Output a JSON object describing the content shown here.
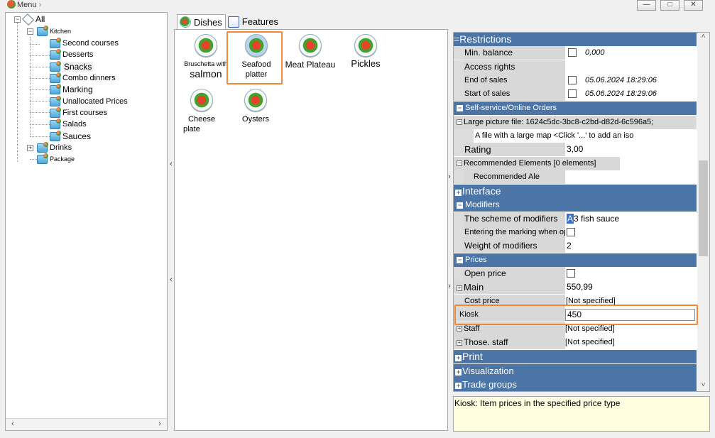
{
  "window": {
    "title": "Menu",
    "minimize": "—",
    "maximize": "□",
    "close": "✕"
  },
  "tree": {
    "root": "All",
    "kitchen": "Kitchen",
    "kitchen_items": [
      "Second courses",
      "Desserts",
      "Snacks",
      "Combo dinners",
      "Marking",
      "Unallocated Prices",
      "First courses",
      "Salads",
      "Sauces"
    ],
    "drinks": "Drinks",
    "package": "Package"
  },
  "tabs": {
    "dishes": "Dishes",
    "features": "Features"
  },
  "dishes": [
    {
      "line1": "Bruschetta with",
      "line2": "salmon"
    },
    {
      "line1": "Seafood",
      "line2": "platter"
    },
    {
      "line1": "Meat Plateau",
      "line2": ""
    },
    {
      "line1": "Pickles",
      "line2": ""
    },
    {
      "line1": "Cheese",
      "line2": "plate"
    },
    {
      "line1": "Oysters",
      "line2": ""
    }
  ],
  "properties": {
    "restrictions": "=Restrictions",
    "min_balance": {
      "name": "Min. balance",
      "value": "0,000"
    },
    "access_rights": {
      "name": "Access rights"
    },
    "end_of_sales": {
      "name": "End of sales",
      "value": "05.06.2024 18:29:06"
    },
    "start_of_sales": {
      "name": "Start of sales",
      "value": "05.06.2024 18:29:06"
    },
    "self_service": "Self-service/Online Orders",
    "large_picture": "Large picture file: 1624c5dc-3bc8-c2bd-d82d-6c596a5;",
    "large_map_hint": "A file with a large map <Click '...' to add an iso",
    "rating": {
      "name": "Rating",
      "value": "3,00"
    },
    "recommended": "Recommended Elements [0 elements]",
    "recommended_ale": "Recommended Ale",
    "interface": "Interface",
    "modifiers": "Modifiers",
    "scheme": {
      "name": "The scheme of modifiers",
      "value": "3 fish sauce",
      "prefix": "A"
    },
    "entering_marking": {
      "name": "Entering the marking when opl"
    },
    "weight_modifiers": {
      "name": "Weight of modifiers",
      "value": "2"
    },
    "prices": "Prices",
    "open_price": {
      "name": "Open price"
    },
    "main": {
      "name": "Main",
      "value": "550,99"
    },
    "cost_price": {
      "name": "Cost price",
      "value": "[Not specified]"
    },
    "kiosk": {
      "name": "Kiosk",
      "value": "450"
    },
    "staff": {
      "name": "Staff",
      "value": "[Not specified]"
    },
    "those_staff": {
      "name": "Those. staff",
      "value": "[Not specified]"
    },
    "print": "Print",
    "visualization": "Visualization",
    "trade_groups": "Trade groups"
  },
  "description": "Kiosk: Item prices in the specified price type",
  "colors": {
    "category_header": "#4a75a6",
    "highlight": "#f0883c",
    "description_bg": "#ffffe1"
  }
}
